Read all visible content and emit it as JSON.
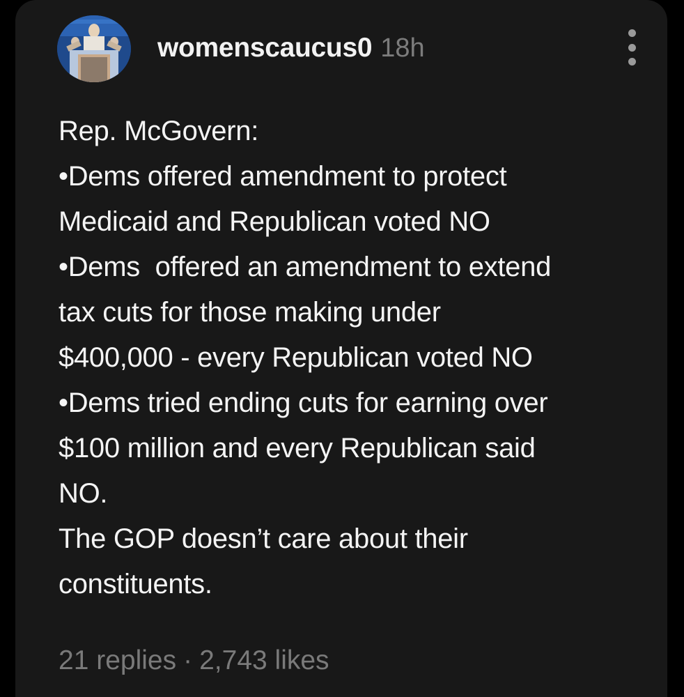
{
  "post": {
    "username": "womenscaucus0",
    "timestamp": "18h",
    "body_lines": [
      "Rep. McGovern:",
      "•Dems offered amendment to protect",
      "Medicaid and Republican voted NO",
      "•Dems  offered an amendment to extend",
      "tax cuts for those making under",
      "$400,000 - every Republican voted NO",
      "•Dems tried ending cuts for earning over",
      "$100 million and every Republican said",
      "NO.",
      "The GOP doesn’t care about their",
      "constituents."
    ],
    "replies": "21 replies",
    "separator": "·",
    "likes": "2,743 likes"
  },
  "icons": {
    "avatar": "profile-photo",
    "menu": "more-vertical-icon"
  },
  "colors": {
    "page_background": "#000000",
    "card_background": "#181818",
    "text_primary": "#f4f4f4",
    "text_secondary": "#7a7a7a"
  }
}
